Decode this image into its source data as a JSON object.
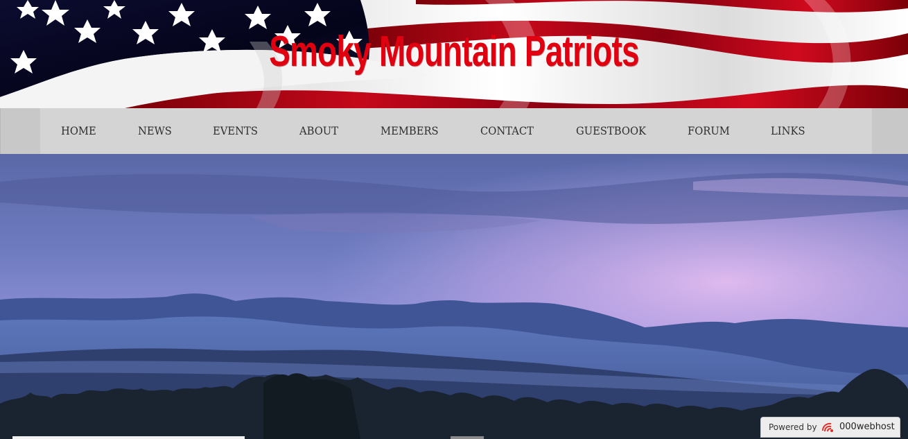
{
  "site": {
    "title": "Smoky Mountain Patriots"
  },
  "nav": {
    "items": [
      {
        "label": "HOME"
      },
      {
        "label": "NEWS"
      },
      {
        "label": "EVENTS"
      },
      {
        "label": "ABOUT"
      },
      {
        "label": "MEMBERS"
      },
      {
        "label": "CONTACT"
      },
      {
        "label": "GUESTBOOK"
      },
      {
        "label": "FORUM"
      },
      {
        "label": "LINKS"
      }
    ]
  },
  "footer_badge": {
    "prefix": "Powered by",
    "brand": "000webhost",
    "icon": "000webhost-logo-icon"
  },
  "colors": {
    "title_red": "#e00010",
    "nav_bg": "#d4d4d4",
    "flag_blue": "#0a0a2a",
    "flag_red": "#b00010"
  }
}
